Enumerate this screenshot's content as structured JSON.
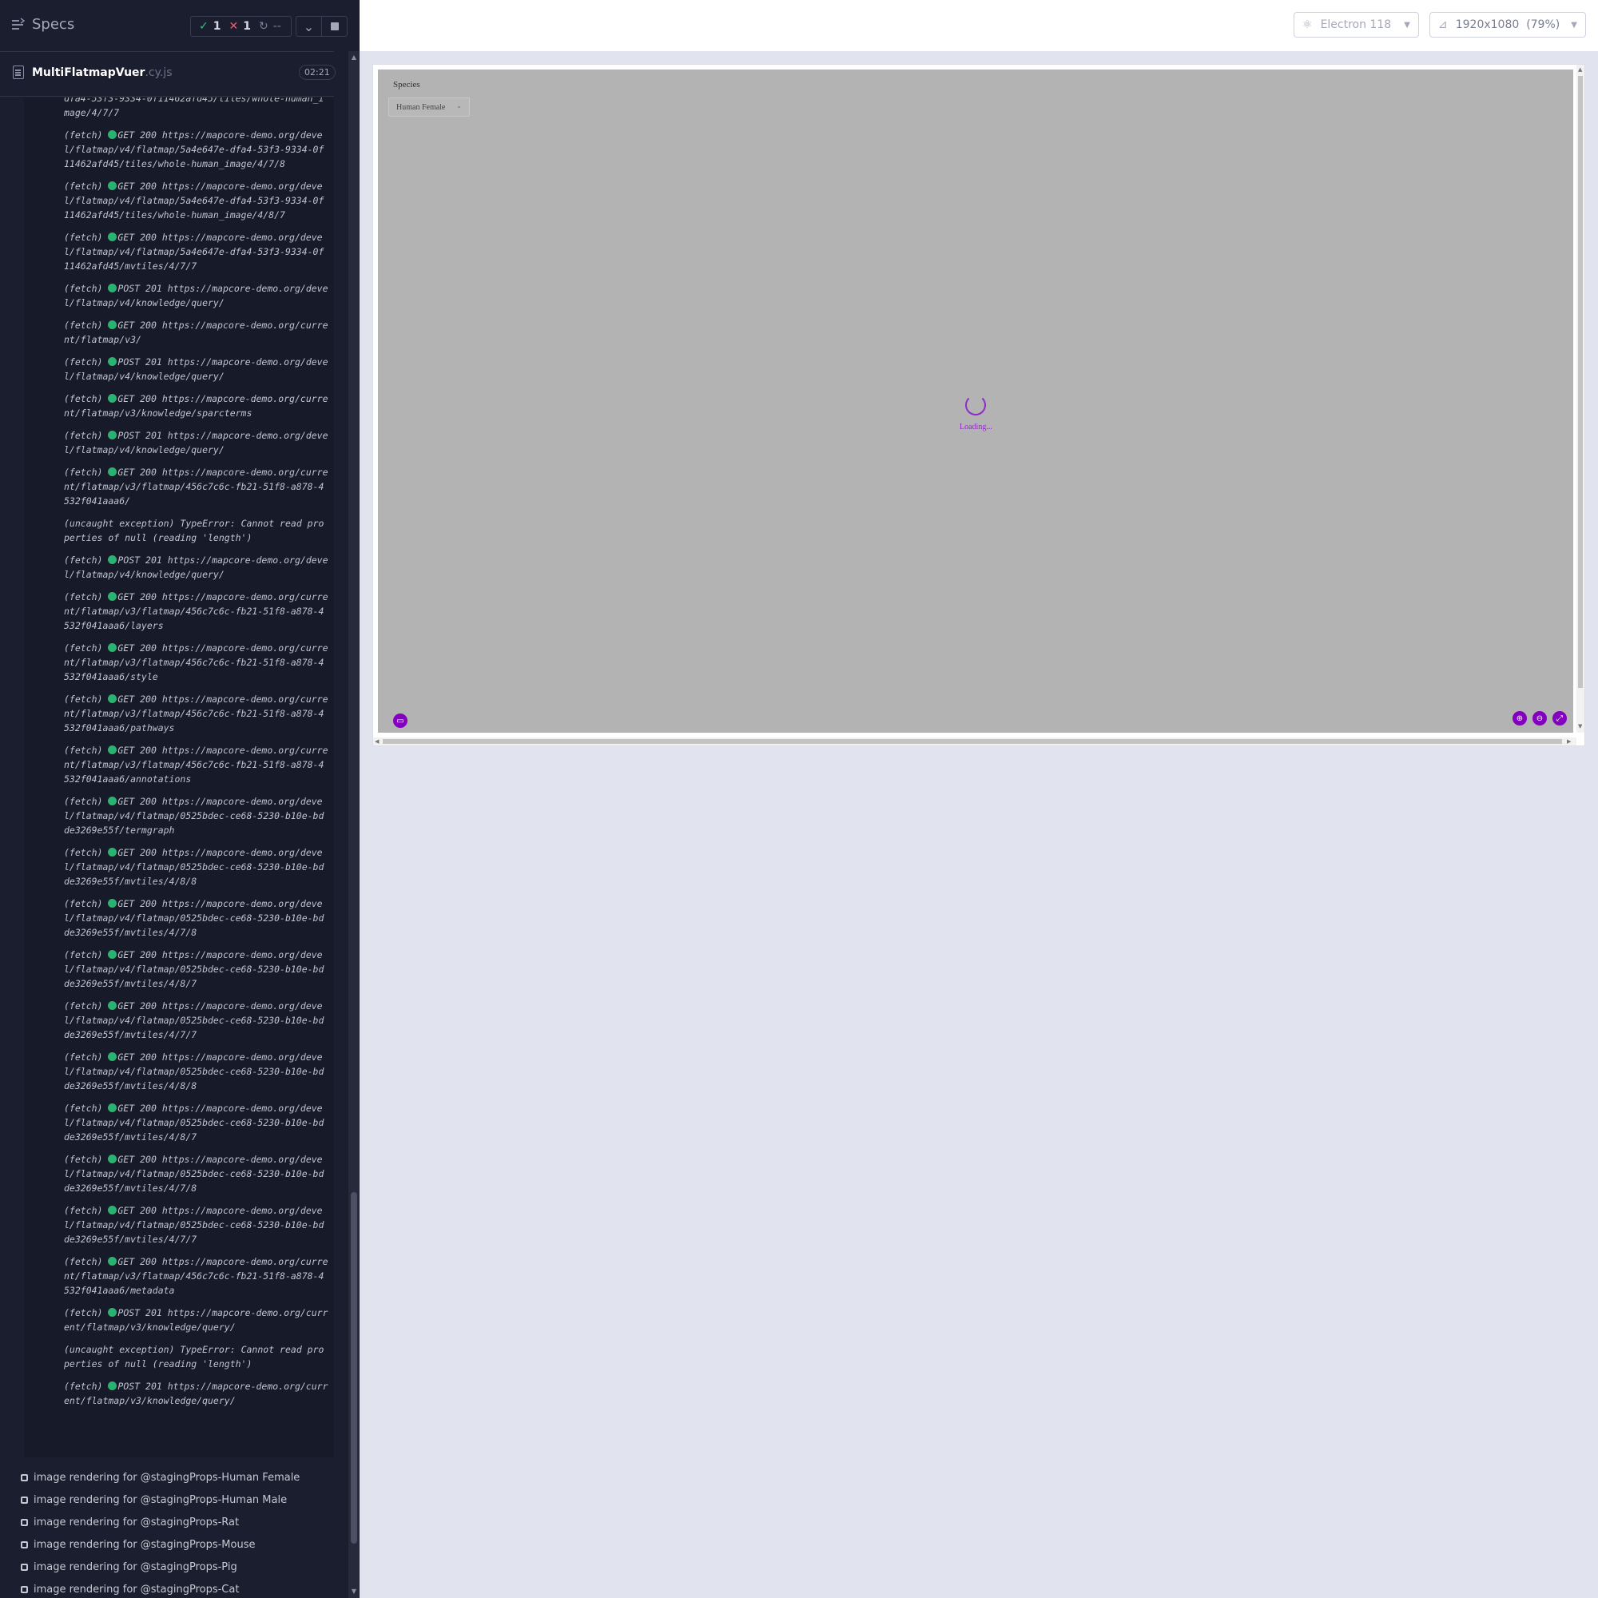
{
  "reporter": {
    "title": "Specs",
    "stats": {
      "passed": "1",
      "failed": "1",
      "pending": "--"
    },
    "file": {
      "name": "MultiFlatmapVuer",
      "ext": ".cy.js",
      "duration": "02:21"
    },
    "logs": [
      {
        "type": "",
        "status": "",
        "text": "dfa4-53f3-9334-0f11462afd45/tiles/whole-human_image/4/7/7"
      },
      {
        "type": "(fetch)",
        "status": "GET 200",
        "text": "https://mapcore-demo.org/devel/flatmap/v4/flatmap/5a4e647e-dfa4-53f3-9334-0f11462afd45/tiles/whole-human_image/4/7/8"
      },
      {
        "type": "(fetch)",
        "status": "GET 200",
        "text": "https://mapcore-demo.org/devel/flatmap/v4/flatmap/5a4e647e-dfa4-53f3-9334-0f11462afd45/tiles/whole-human_image/4/8/7"
      },
      {
        "type": "(fetch)",
        "status": "GET 200",
        "text": "https://mapcore-demo.org/devel/flatmap/v4/flatmap/5a4e647e-dfa4-53f3-9334-0f11462afd45/mvtiles/4/7/7"
      },
      {
        "type": "(fetch)",
        "status": "POST 201",
        "text": "https://mapcore-demo.org/devel/flatmap/v4/knowledge/query/"
      },
      {
        "type": "(fetch)",
        "status": "GET 200",
        "text": "https://mapcore-demo.org/current/flatmap/v3/"
      },
      {
        "type": "(fetch)",
        "status": "POST 201",
        "text": "https://mapcore-demo.org/devel/flatmap/v4/knowledge/query/"
      },
      {
        "type": "(fetch)",
        "status": "GET 200",
        "text": "https://mapcore-demo.org/current/flatmap/v3/knowledge/sparcterms"
      },
      {
        "type": "(fetch)",
        "status": "POST 201",
        "text": "https://mapcore-demo.org/devel/flatmap/v4/knowledge/query/"
      },
      {
        "type": "(fetch)",
        "status": "GET 200",
        "text": "https://mapcore-demo.org/current/flatmap/v3/flatmap/456c7c6c-fb21-51f8-a878-4532f041aaa6/"
      },
      {
        "type": "(uncaught exception)",
        "status": "",
        "text": "TypeError: Cannot read properties of null (reading 'length')"
      },
      {
        "type": "(fetch)",
        "status": "POST 201",
        "text": "https://mapcore-demo.org/devel/flatmap/v4/knowledge/query/"
      },
      {
        "type": "(fetch)",
        "status": "GET 200",
        "text": "https://mapcore-demo.org/current/flatmap/v3/flatmap/456c7c6c-fb21-51f8-a878-4532f041aaa6/layers"
      },
      {
        "type": "(fetch)",
        "status": "GET 200",
        "text": "https://mapcore-demo.org/current/flatmap/v3/flatmap/456c7c6c-fb21-51f8-a878-4532f041aaa6/style"
      },
      {
        "type": "(fetch)",
        "status": "GET 200",
        "text": "https://mapcore-demo.org/current/flatmap/v3/flatmap/456c7c6c-fb21-51f8-a878-4532f041aaa6/pathways"
      },
      {
        "type": "(fetch)",
        "status": "GET 200",
        "text": "https://mapcore-demo.org/current/flatmap/v3/flatmap/456c7c6c-fb21-51f8-a878-4532f041aaa6/annotations"
      },
      {
        "type": "(fetch)",
        "status": "GET 200",
        "text": "https://mapcore-demo.org/devel/flatmap/v4/flatmap/0525bdec-ce68-5230-b10e-bdde3269e55f/termgraph"
      },
      {
        "type": "(fetch)",
        "status": "GET 200",
        "text": "https://mapcore-demo.org/devel/flatmap/v4/flatmap/0525bdec-ce68-5230-b10e-bdde3269e55f/mvtiles/4/8/8"
      },
      {
        "type": "(fetch)",
        "status": "GET 200",
        "text": "https://mapcore-demo.org/devel/flatmap/v4/flatmap/0525bdec-ce68-5230-b10e-bdde3269e55f/mvtiles/4/7/8"
      },
      {
        "type": "(fetch)",
        "status": "GET 200",
        "text": "https://mapcore-demo.org/devel/flatmap/v4/flatmap/0525bdec-ce68-5230-b10e-bdde3269e55f/mvtiles/4/8/7"
      },
      {
        "type": "(fetch)",
        "status": "GET 200",
        "text": "https://mapcore-demo.org/devel/flatmap/v4/flatmap/0525bdec-ce68-5230-b10e-bdde3269e55f/mvtiles/4/7/7"
      },
      {
        "type": "(fetch)",
        "status": "GET 200",
        "text": "https://mapcore-demo.org/devel/flatmap/v4/flatmap/0525bdec-ce68-5230-b10e-bdde3269e55f/mvtiles/4/8/8"
      },
      {
        "type": "(fetch)",
        "status": "GET 200",
        "text": "https://mapcore-demo.org/devel/flatmap/v4/flatmap/0525bdec-ce68-5230-b10e-bdde3269e55f/mvtiles/4/8/7"
      },
      {
        "type": "(fetch)",
        "status": "GET 200",
        "text": "https://mapcore-demo.org/devel/flatmap/v4/flatmap/0525bdec-ce68-5230-b10e-bdde3269e55f/mvtiles/4/7/8"
      },
      {
        "type": "(fetch)",
        "status": "GET 200",
        "text": "https://mapcore-demo.org/devel/flatmap/v4/flatmap/0525bdec-ce68-5230-b10e-bdde3269e55f/mvtiles/4/7/7"
      },
      {
        "type": "(fetch)",
        "status": "GET 200",
        "text": "https://mapcore-demo.org/current/flatmap/v3/flatmap/456c7c6c-fb21-51f8-a878-4532f041aaa6/metadata"
      },
      {
        "type": "(fetch)",
        "status": "POST 201",
        "text": "https://mapcore-demo.org/current/flatmap/v3/knowledge/query/"
      },
      {
        "type": "(uncaught exception)",
        "status": "",
        "text": "TypeError: Cannot read properties of null (reading 'length')"
      },
      {
        "type": "(fetch)",
        "status": "POST 201",
        "text": "https://mapcore-demo.org/current/flatmap/v3/knowledge/query/"
      }
    ],
    "tests": [
      "image rendering for @stagingProps-Human Female",
      "image rendering for @stagingProps-Human Male",
      "image rendering for @stagingProps-Rat",
      "image rendering for @stagingProps-Mouse",
      "image rendering for @stagingProps-Pig",
      "image rendering for @stagingProps-Cat"
    ]
  },
  "aut": {
    "browser": "Electron 118",
    "viewport": "1920x1080",
    "zoom": "(79%)",
    "species_label": "Species",
    "species_value": "Human Female",
    "loading_text": "Loading..."
  },
  "colors": {
    "reporter_bg": "#1b1e2e",
    "pass": "#2ec47c",
    "fail": "#f15a72",
    "accent_purple": "#8300bf",
    "map_bg": "#b3b3b3"
  }
}
